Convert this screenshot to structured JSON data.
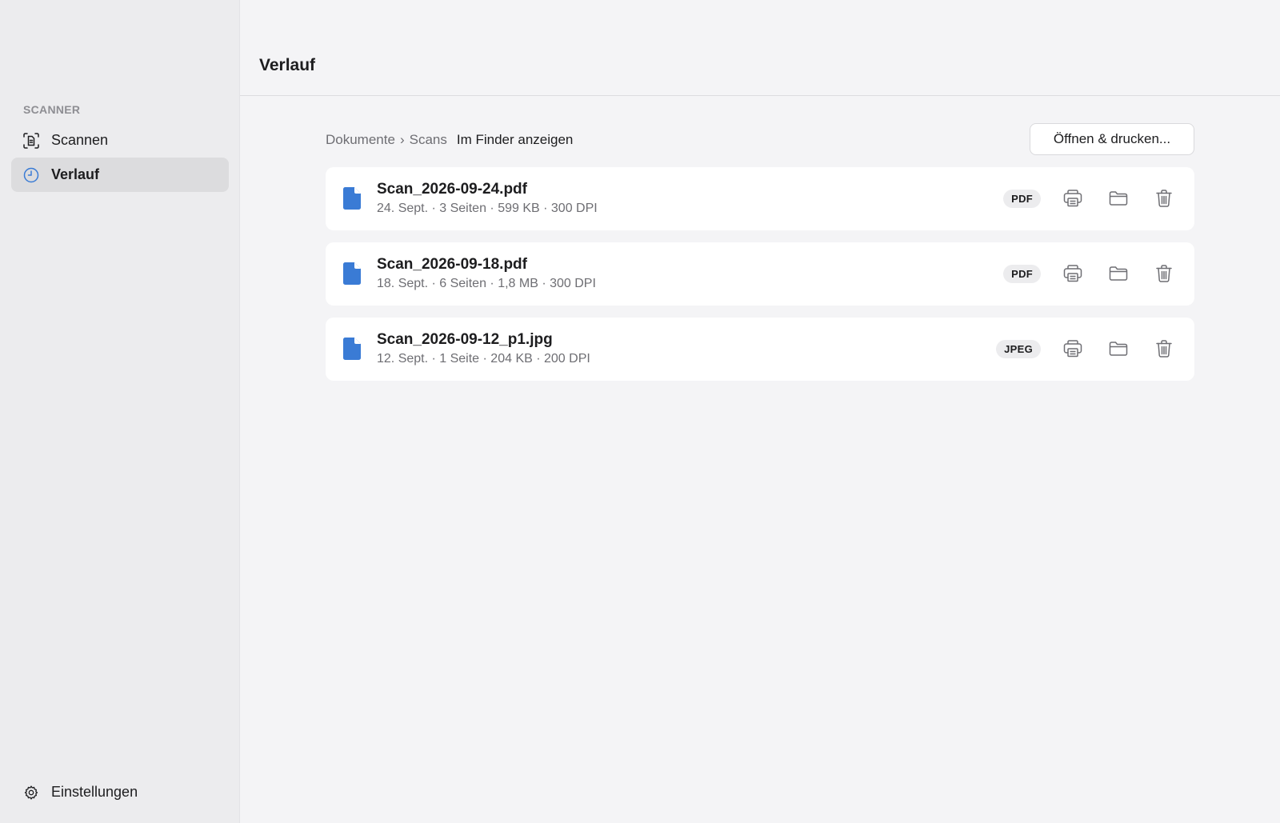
{
  "sidebar": {
    "section_label": "SCANNER",
    "items": [
      {
        "label": "Scannen",
        "icon": "document-scan-icon",
        "active": false
      },
      {
        "label": "Verlauf",
        "icon": "clock-icon",
        "active": true
      }
    ],
    "settings_label": "Einstellungen",
    "settings_icon": "gear-icon"
  },
  "header": {
    "title": "Verlauf"
  },
  "toolbar": {
    "breadcrumb": [
      "Dokumente",
      "Scans"
    ],
    "breadcrumb_separator": "›",
    "finder_link": "Im Finder anzeigen",
    "open_print_label": "Öffnen & drucken..."
  },
  "files": [
    {
      "name": "Scan_2026-09-24.pdf",
      "meta": "24. Sept. · 3 Seiten · 599 KB · 300 DPI",
      "type": "PDF"
    },
    {
      "name": "Scan_2026-09-18.pdf",
      "meta": "18. Sept. · 6 Seiten · 1,8 MB · 300 DPI",
      "type": "PDF"
    },
    {
      "name": "Scan_2026-09-12_p1.jpg",
      "meta": "12. Sept. · 1 Seite · 204 KB · 200 DPI",
      "type": "JPEG"
    }
  ],
  "colors": {
    "accent": "#3a7bd5",
    "icon_gray": "#6e6e73"
  }
}
